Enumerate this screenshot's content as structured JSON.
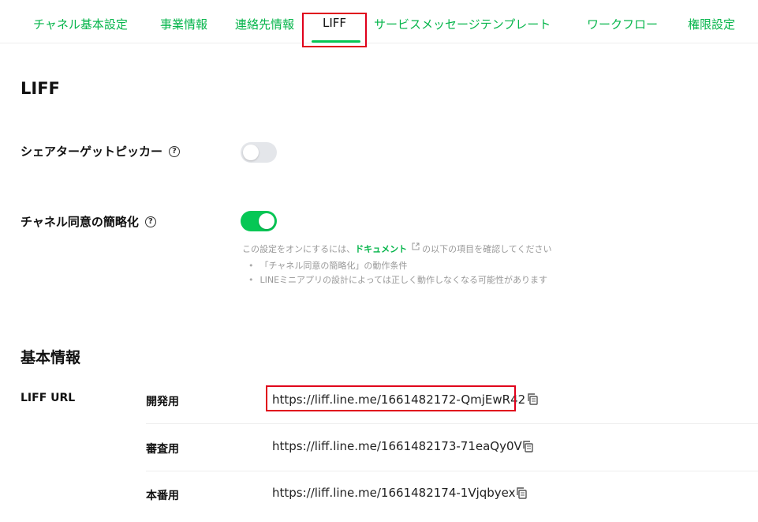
{
  "tabs": [
    {
      "label": "チャネル基本設定"
    },
    {
      "label": "事業情報"
    },
    {
      "label": "連絡先情報"
    },
    {
      "label": "LIFF"
    },
    {
      "label": "サービスメッセージテンプレート"
    },
    {
      "label": "ワークフロー"
    },
    {
      "label": "権限設定"
    }
  ],
  "active_tab": "LIFF",
  "page_title": "LIFF",
  "settings": {
    "share_target_picker": {
      "label": "シェアターゲットピッカー",
      "enabled": false
    },
    "channel_consent": {
      "label": "チャネル同意の簡略化",
      "enabled": true
    }
  },
  "hint": {
    "prefix": "この設定をオンにするには、",
    "link": "ドキュメント",
    "suffix": "の以下の項目を確認してください",
    "items": [
      "「チャネル同意の簡略化」の動作条件",
      "LINEミニアプリの設計によっては正しく動作しなくなる可能性があります"
    ]
  },
  "basic_info": {
    "title": "基本情報",
    "liff_url_label": "LIFF URL",
    "rows": [
      {
        "label": "開発用",
        "url": "https://liff.line.me/1661482172-QmjEwR42"
      },
      {
        "label": "審査用",
        "url": "https://liff.line.me/1661482173-71eaQy0V"
      },
      {
        "label": "本番用",
        "url": "https://liff.line.me/1661482174-1Vjqbyex"
      }
    ]
  },
  "colors": {
    "accent": "#06c755",
    "highlight": "#e0001b"
  }
}
